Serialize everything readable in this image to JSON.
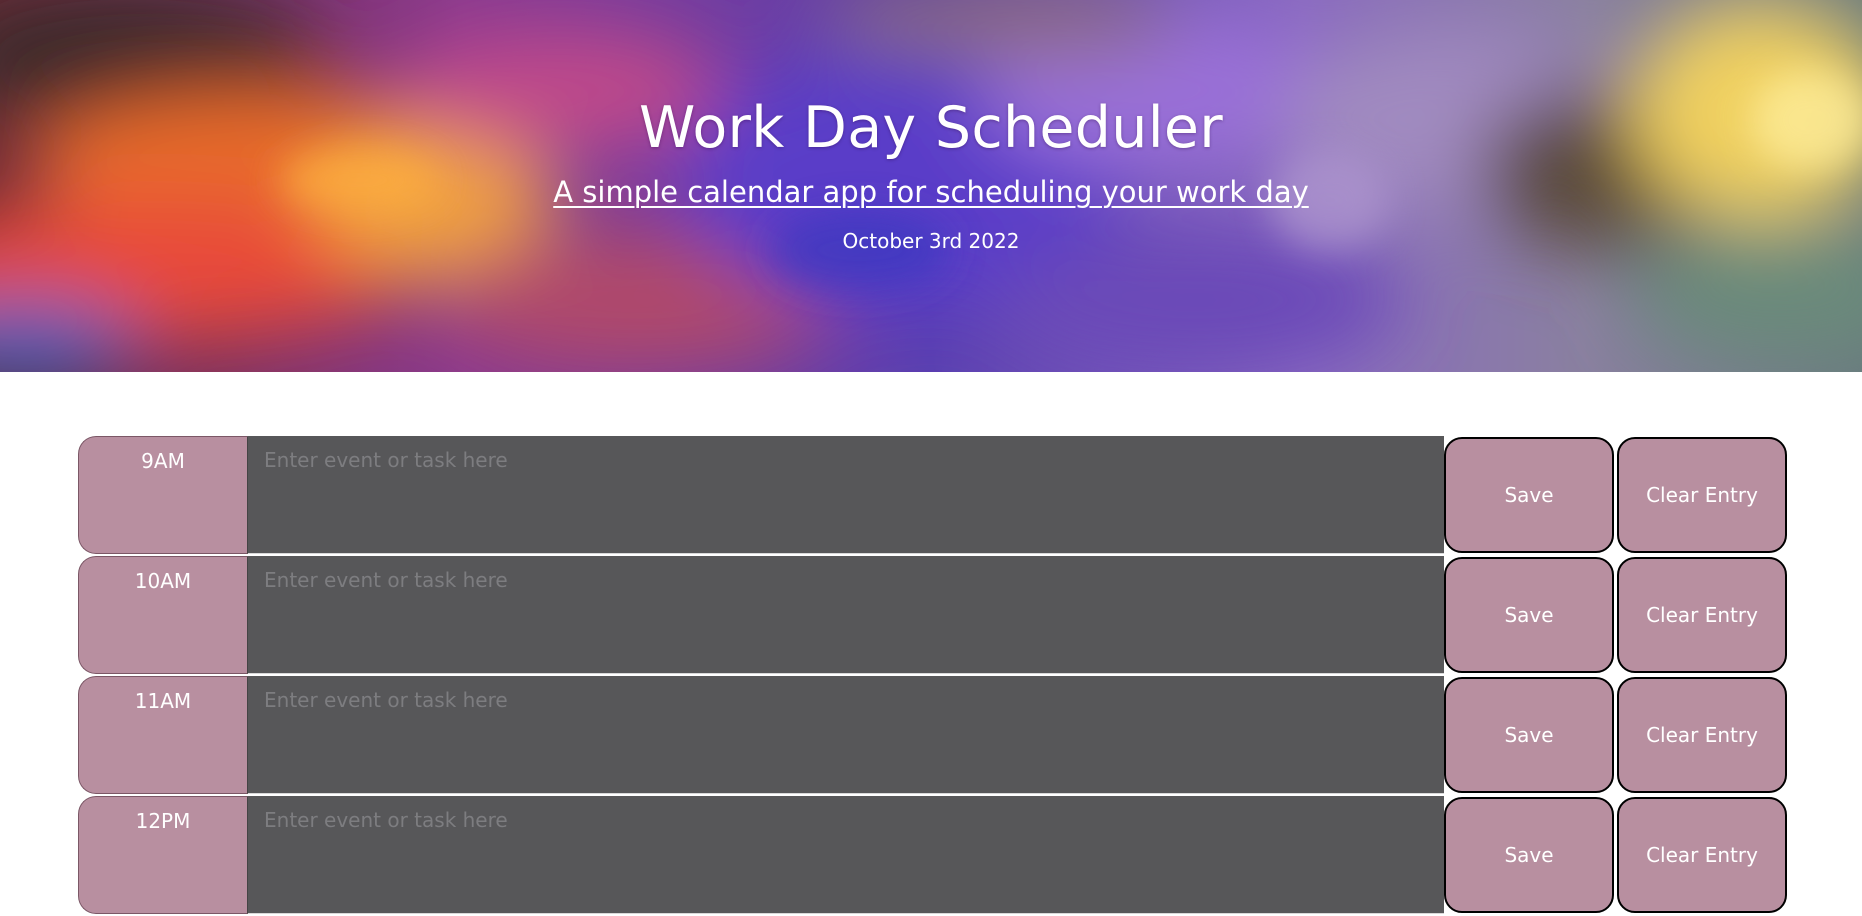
{
  "header": {
    "title": "Work Day Scheduler",
    "subtitle": "A simple calendar app for scheduling your work day",
    "date": "October 3rd 2022"
  },
  "schedule": {
    "placeholder": "Enter event or task here",
    "save_label": "Save",
    "clear_label": "Clear Entry",
    "hours": [
      "9AM",
      "10AM",
      "11AM",
      "12PM"
    ]
  },
  "colors": {
    "hour_bg": "#b88fa0",
    "textarea_bg": "#575759",
    "border": "#000000"
  }
}
